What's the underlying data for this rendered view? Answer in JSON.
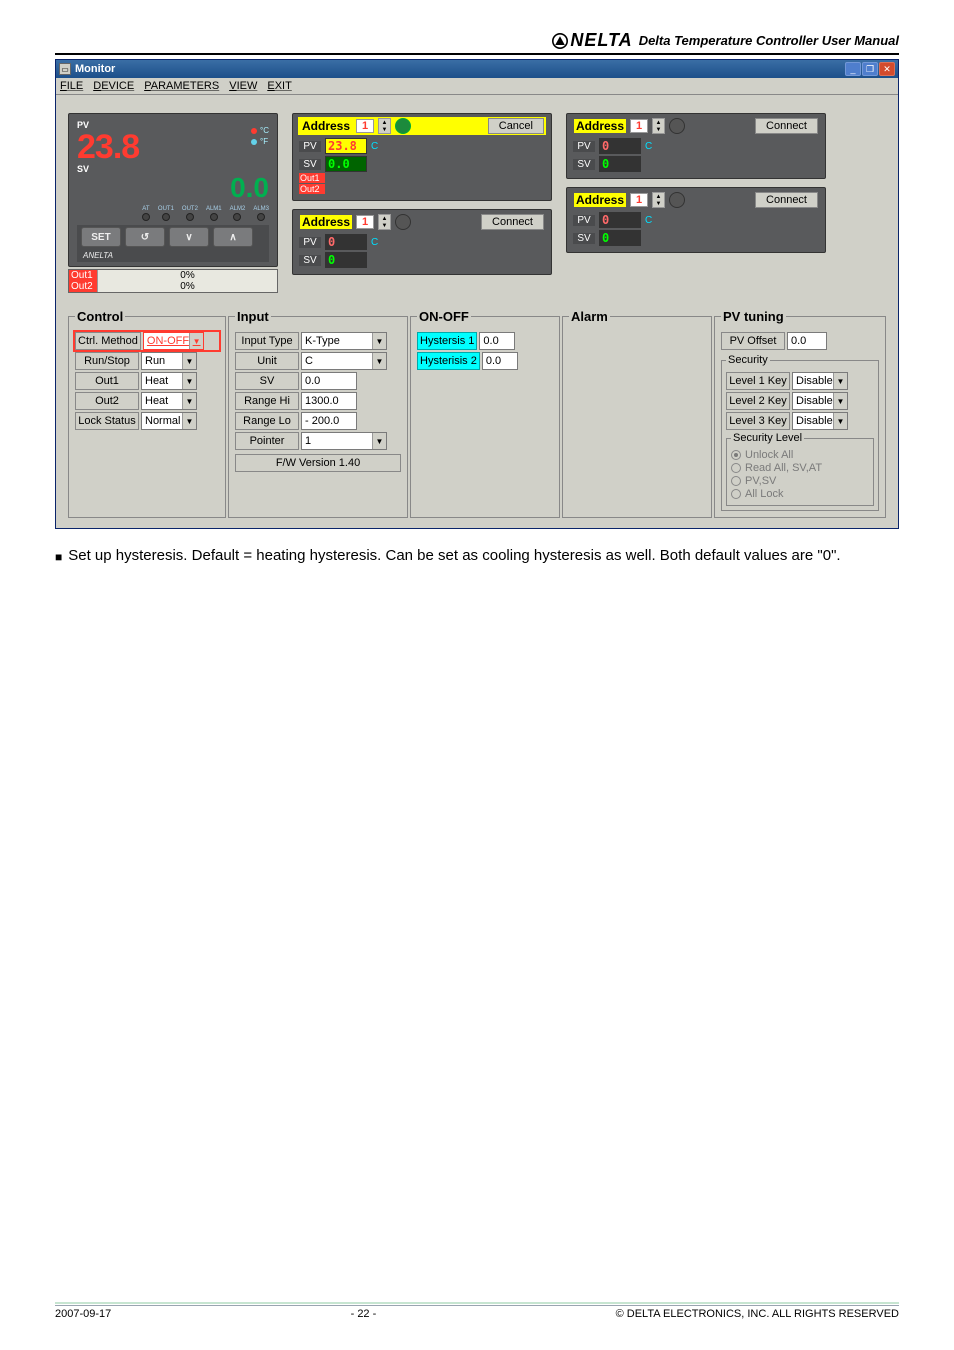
{
  "doc_header": "Delta Temperature Controller User Manual",
  "logo_text": "NELTA",
  "window": {
    "title": "Monitor"
  },
  "menubar": [
    "FILE",
    "DEVICE",
    "PARAMETERS",
    "VIEW",
    "EXIT"
  ],
  "device": {
    "pv_label": "PV",
    "pv_value": "23.8",
    "sv_label": "SV",
    "sv_value": "0.0",
    "unit_c": "°C",
    "unit_f": "°F",
    "leds": [
      "AT",
      "OUT1",
      "OUT2",
      "ALM1",
      "ALM2",
      "ALM3"
    ],
    "btns": [
      "SET",
      "↺",
      "∨",
      "∧"
    ],
    "brand": "ANELTA",
    "out1_label": "Out1",
    "out1_val": "0%",
    "out2_label": "Out2",
    "out2_val": "0%"
  },
  "addr": {
    "label": "Address",
    "cancel": "Cancel",
    "connect": "Connect",
    "pv": "PV",
    "sv": "SV",
    "c": "C",
    "p1_num": "1",
    "p1_pv": "23.8",
    "p1_sv": "0.0",
    "p1_out1": "Out1",
    "p1_out2": "Out2",
    "p2_num": "1",
    "p2_pv": "0",
    "p2_sv": "0",
    "p3_num": "1",
    "p3_pv": "0",
    "p3_sv": "0",
    "p4_num": "1",
    "p4_pv": "0",
    "p4_sv": "0"
  },
  "control": {
    "legend": "Control",
    "ctrl_method_label": "Ctrl. Method",
    "ctrl_method_val": "ON-OFF",
    "runstop_label": "Run/Stop",
    "runstop_val": "Run",
    "out1_label": "Out1",
    "out1_val": "Heat",
    "out2_label": "Out2",
    "out2_val": "Heat",
    "lock_label": "Lock Status",
    "lock_val": "Normal"
  },
  "input": {
    "legend": "Input",
    "type_label": "Input Type",
    "type_val": "K-Type",
    "unit_label": "Unit",
    "unit_val": "C",
    "sv_label": "SV",
    "sv_val": "0.0",
    "rhi_label": "Range Hi",
    "rhi_val": "1300.0",
    "rlo_label": "Range Lo",
    "rlo_val": "- 200.0",
    "ptr_label": "Pointer",
    "ptr_val": "1",
    "fw": "F/W Version 1.40"
  },
  "onoff": {
    "legend": "ON-OFF",
    "h1_label": "Hystersis 1",
    "h1_val": "0.0",
    "h2_label": "Hysterisis 2",
    "h2_val": "0.0"
  },
  "alarm": {
    "legend": "Alarm"
  },
  "pvtuning": {
    "legend": "PV tuning",
    "offset_label": "PV Offset",
    "offset_val": "0.0",
    "security_legend": "Security",
    "l1": "Level 1 Key",
    "l2": "Level 2 Key",
    "l3": "Level 3 Key",
    "disable": "Disable",
    "seclevel_legend": "Security Level",
    "r1": "Unlock All",
    "r2": "Read All, SV,AT",
    "r3": "PV,SV",
    "r4": "All Lock"
  },
  "body_text": "Set up hysteresis. Default = heating hysteresis. Can be set as cooling hysteresis as well. Both default values are \"0\".",
  "footer": {
    "date": "2007-09-17",
    "page": "- 22 -",
    "copy": "© DELTA ELECTRONICS, INC. ALL RIGHTS RESERVED"
  }
}
